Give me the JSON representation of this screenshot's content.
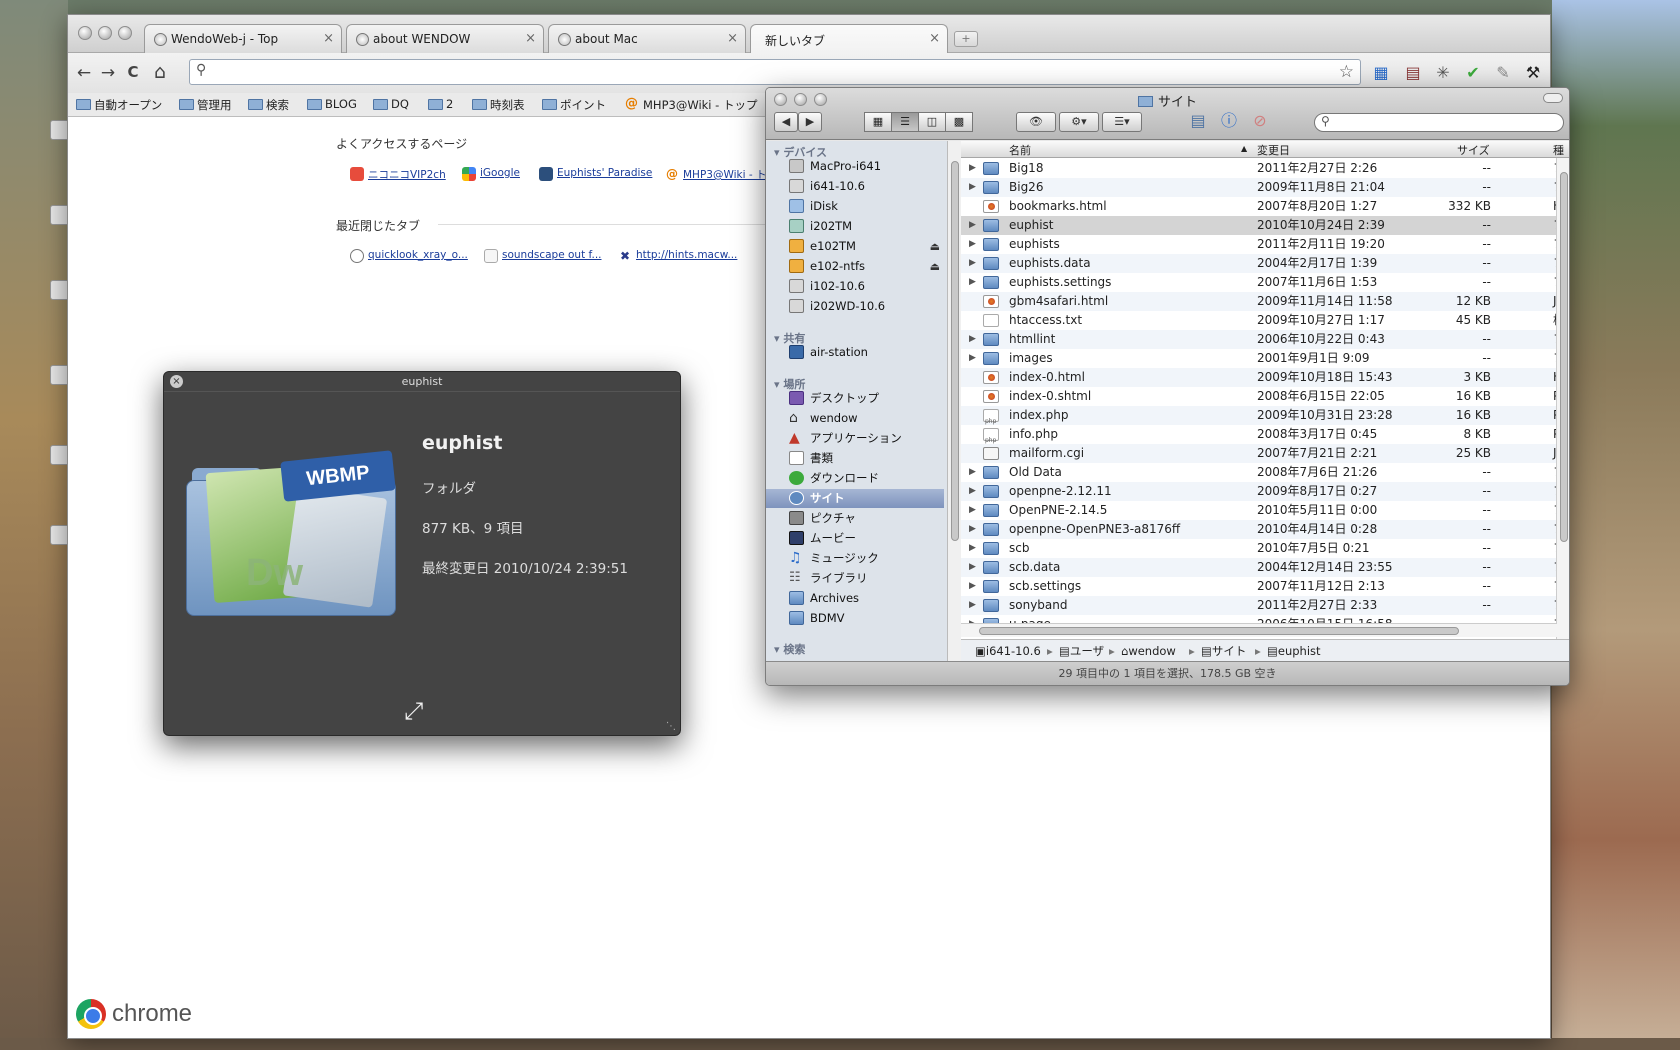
{
  "chrome": {
    "tabs": [
      {
        "label": "WendoWeb-j - Top"
      },
      {
        "label": "about WENDOW"
      },
      {
        "label": "about Mac"
      },
      {
        "label": "新しいタブ"
      }
    ],
    "tab_close": "×",
    "new_tab": "+",
    "nav": {
      "back": "←",
      "forward": "→",
      "reload": "C",
      "home": "⌂"
    },
    "omnibox_value": "",
    "bookmarks": [
      {
        "label": "自動オープン"
      },
      {
        "label": "管理用"
      },
      {
        "label": "検索"
      },
      {
        "label": "BLOG"
      },
      {
        "label": "DQ"
      },
      {
        "label": "2"
      },
      {
        "label": "時刻表"
      },
      {
        "label": "ポイント"
      },
      {
        "label": "MHP3@Wiki - トップ"
      }
    ],
    "ntp": {
      "most_visited_heading": "よくアクセスするページ",
      "most_visited": [
        {
          "label": "ニコニコVIP2ch"
        },
        {
          "label": "iGoogle"
        },
        {
          "label": "Euphists' Paradise"
        },
        {
          "label": "MHP3@Wiki - ト..."
        }
      ],
      "recent_heading": "最近閉じたタブ",
      "recent": [
        {
          "label": "quicklook_xray_o..."
        },
        {
          "label": "soundscape out f..."
        },
        {
          "label": "http://hints.macw..."
        }
      ]
    },
    "brand": "chrome"
  },
  "quicklook": {
    "title": "euphist",
    "close": "×",
    "name": "euphist",
    "kind": "フォルダ",
    "size_items": "877 KB、9 項目",
    "modified": "最終変更日 2010/10/24 2:39:51",
    "badge": "WBMP",
    "badge2": "Dw"
  },
  "finder": {
    "title": "サイト",
    "search_placeholder": "",
    "sidebar": {
      "devices_label": "デバイス",
      "devices": [
        {
          "label": "MacPro-i641",
          "eject": false
        },
        {
          "label": "i641-10.6",
          "eject": false
        },
        {
          "label": "iDisk",
          "eject": false
        },
        {
          "label": "i202TM",
          "eject": false
        },
        {
          "label": "e102TM",
          "eject": true
        },
        {
          "label": "e102-ntfs",
          "eject": true
        },
        {
          "label": "i102-10.6",
          "eject": false
        },
        {
          "label": "i202WD-10.6",
          "eject": false
        }
      ],
      "shared_label": "共有",
      "shared": [
        {
          "label": "air-station"
        }
      ],
      "places_label": "場所",
      "places": [
        {
          "label": "デスクトップ"
        },
        {
          "label": "wendow"
        },
        {
          "label": "アプリケーション"
        },
        {
          "label": "書類"
        },
        {
          "label": "ダウンロード"
        },
        {
          "label": "サイト",
          "selected": true
        },
        {
          "label": "ピクチャ"
        },
        {
          "label": "ムービー"
        },
        {
          "label": "ミュージック"
        },
        {
          "label": "ライブラリ"
        },
        {
          "label": "Archives"
        },
        {
          "label": "BDMV"
        }
      ],
      "search_label": "検索"
    },
    "columns": {
      "name": "名前",
      "date": "変更日",
      "size": "サイズ",
      "kind": "種"
    },
    "rows": [
      {
        "name": "Big18",
        "date": "2011年2月27日 2:26",
        "size": "--",
        "kind": "フ",
        "type": "folder"
      },
      {
        "name": "Big26",
        "date": "2009年11月8日 21:04",
        "size": "--",
        "kind": "フ",
        "type": "folder"
      },
      {
        "name": "bookmarks.html",
        "date": "2007年8月20日 1:27",
        "size": "332 KB",
        "kind": "H",
        "type": "html"
      },
      {
        "name": "euphist",
        "date": "2010年10月24日 2:39",
        "size": "--",
        "kind": "フ",
        "type": "folder",
        "selected": true
      },
      {
        "name": "euphists",
        "date": "2011年2月11日 19:20",
        "size": "--",
        "kind": "フ",
        "type": "folder"
      },
      {
        "name": "euphists.data",
        "date": "2004年2月17日 1:39",
        "size": "--",
        "kind": "フ",
        "type": "folder"
      },
      {
        "name": "euphists.settings",
        "date": "2007年11月6日 1:53",
        "size": "--",
        "kind": "フ",
        "type": "folder"
      },
      {
        "name": "gbm4safari.html",
        "date": "2009年11月14日 11:58",
        "size": "12 KB",
        "kind": "Je",
        "type": "html"
      },
      {
        "name": "htaccess.txt",
        "date": "2009年10月27日 1:17",
        "size": "45 KB",
        "kind": "標",
        "type": "txt"
      },
      {
        "name": "htmllint",
        "date": "2006年10月22日 0:43",
        "size": "--",
        "kind": "フ",
        "type": "folder"
      },
      {
        "name": "images",
        "date": "2001年9月1日 9:09",
        "size": "--",
        "kind": "フ",
        "type": "folder"
      },
      {
        "name": "index-0.html",
        "date": "2009年10月18日 15:43",
        "size": "3 KB",
        "kind": "H",
        "type": "html"
      },
      {
        "name": "index-0.shtml",
        "date": "2008年6月15日 22:05",
        "size": "16 KB",
        "kind": "P",
        "type": "html"
      },
      {
        "name": "index.php",
        "date": "2009年10月31日 23:28",
        "size": "16 KB",
        "kind": "P",
        "type": "php"
      },
      {
        "name": "info.php",
        "date": "2008年3月17日 0:45",
        "size": "8 KB",
        "kind": "P",
        "type": "php"
      },
      {
        "name": "mailform.cgi",
        "date": "2007年7月21日 2:21",
        "size": "25 KB",
        "kind": "Je",
        "type": "cgi"
      },
      {
        "name": "Old Data",
        "date": "2008年7月6日 21:26",
        "size": "--",
        "kind": "フ",
        "type": "folder"
      },
      {
        "name": "openpne-2.12.11",
        "date": "2009年8月17日 0:27",
        "size": "--",
        "kind": "フ",
        "type": "folder"
      },
      {
        "name": "OpenPNE-2.14.5",
        "date": "2010年5月11日 0:00",
        "size": "--",
        "kind": "フ",
        "type": "folder"
      },
      {
        "name": "openpne-OpenPNE3-a8176ff",
        "date": "2010年4月14日 0:28",
        "size": "--",
        "kind": "フ",
        "type": "folder"
      },
      {
        "name": "scb",
        "date": "2010年7月5日 0:21",
        "size": "--",
        "kind": "フ",
        "type": "folder"
      },
      {
        "name": "scb.data",
        "date": "2004年12月14日 23:55",
        "size": "--",
        "kind": "フ",
        "type": "folder"
      },
      {
        "name": "scb.settings",
        "date": "2007年11月12日 2:13",
        "size": "--",
        "kind": "フ",
        "type": "folder"
      },
      {
        "name": "sonyband",
        "date": "2011年2月27日 2:33",
        "size": "--",
        "kind": "フ",
        "type": "folder"
      },
      {
        "name": "u-page",
        "date": "2006年10月15日 16:58",
        "size": "--",
        "kind": "フ",
        "type": "folder"
      }
    ],
    "path": [
      "i641-10.6",
      "ユーザ",
      "wendow",
      "サイト",
      "euphist"
    ],
    "status": "29 項目中の 1 項目を選択、178.5 GB 空き"
  }
}
